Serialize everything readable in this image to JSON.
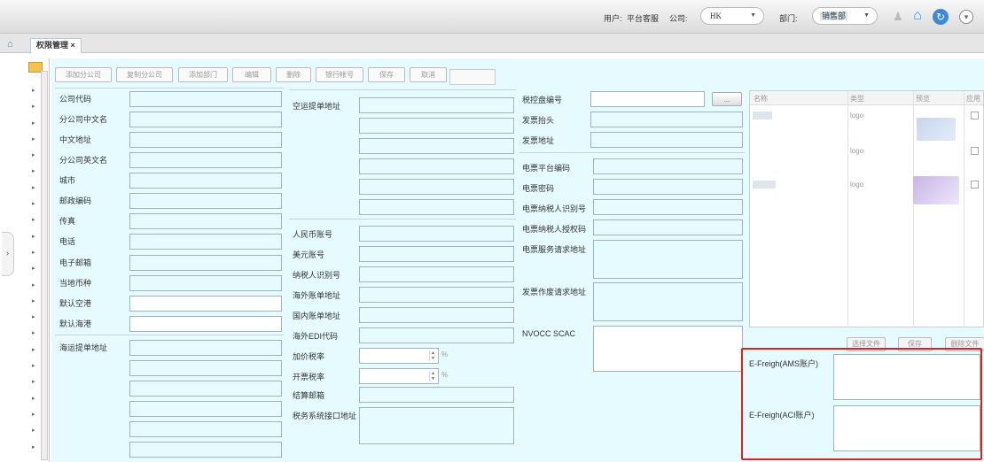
{
  "header": {
    "user_label": "用户:",
    "user_value": "平台客服",
    "company_label": "公司:",
    "company_value": "HK",
    "dept_label": "部门:",
    "dept_value": "销售部"
  },
  "tabs": [
    {
      "label": "权限管理 ×"
    }
  ],
  "toolbar": {
    "add_company": "添加分公司",
    "copy_company": "复制分公司",
    "add_dept": "添加部门",
    "edit": "编辑",
    "delete": "删除",
    "bank_account": "银行帐号",
    "save": "保存",
    "cancel": "取消"
  },
  "col1": {
    "company_code": "公司代码",
    "company_cn_name": "分公司中文名",
    "cn_address": "中文地址",
    "company_en_name": "分公司英文名",
    "city": "城市",
    "postcode": "邮政编码",
    "fax": "传真",
    "phone": "电话",
    "email": "电子邮箱",
    "local_currency": "当地币种",
    "default_airport": "默认空港",
    "default_seaport": "默认海港",
    "sea_bl_address": "海运提单地址"
  },
  "col2": {
    "air_bl_address": "空运提单地址",
    "rmb_account": "人民币账号",
    "usd_account": "美元账号",
    "taxpayer_id": "纳税人识别号",
    "overseas_bill_address": "海外账单地址",
    "domestic_bill_address": "国内账单地址",
    "overseas_edi": "海外EDI代码",
    "markup_rate": "加价税率",
    "invoice_rate": "开票税率",
    "settle_email": "结算邮箱",
    "tax_api_address": "税务系统接口地址"
  },
  "col3": {
    "tax_disk_no": "税控盘编号",
    "disk_button": "...",
    "invoice_title": "发票抬头",
    "invoice_address": "发票地址",
    "einvoice_platform_code": "电票平台编码",
    "einvoice_password": "电票密码",
    "einvoice_taxpayer_id": "电票纳税人识别号",
    "einvoice_auth_code": "电票纳税人授权码",
    "einvoice_service_url": "电票服务请求地址",
    "invoice_void_url": "发票作废请求地址",
    "nvocc_scac": "NVOCC SCAC"
  },
  "grid": {
    "headers": [
      "名称",
      "类型",
      "预览",
      "应用"
    ],
    "rows": [
      {
        "type": "logo"
      },
      {
        "type": "logo"
      },
      {
        "type": "logo"
      }
    ],
    "select_file": "选择文件",
    "save": "保存",
    "delete_file": "删除文件"
  },
  "efreight": {
    "ams_label": "E-Freigh(AMS账户)",
    "aci_label": "E-Freigh(ACI账户)"
  },
  "units": {
    "percent": "%"
  }
}
